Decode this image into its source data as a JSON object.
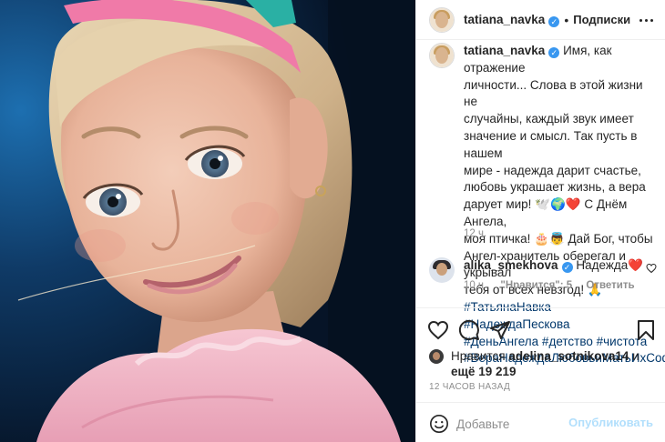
{
  "post": {
    "username": "tatiana_navka",
    "follow_label": "Подписки",
    "caption_lines": [
      "Имя, как отражение",
      "личности... Слова в этой жизни не",
      "случайны, каждый звук имеет",
      "значение и смысл. Так пусть в нашем",
      "мире - надежда дарит счастье,",
      "любовь украшает жизнь, а вера",
      "дарует мир! 🕊️🌍❤️ С Днём Ангела,",
      "моя птичка! 🎂👼 Дай Бог, чтобы",
      "Ангел-хранитель оберегал и укрывал",
      "тебя от всех невзгод! 🙏"
    ],
    "hashtags": [
      "#ТатьянаНавка #НадеждаПескова",
      "#ДеньАнгела #детство #чистота",
      "#ВераНадеждаЛюбовьиМатьИхСофия"
    ],
    "caption_time": "12 ч."
  },
  "comment": {
    "username": "alika_smekhova",
    "text": "Надежда❤️",
    "time": "10 ч.",
    "likes": "\"Нравится\": 5",
    "reply": "Ответить"
  },
  "likes": {
    "prefix": "Нравится",
    "user": "adelina_sotnikova14",
    "and": "и",
    "more_prefix": "ещё",
    "more_count": "19 219"
  },
  "timestamp": "12 часов назад",
  "composer": {
    "placeholder": "Добавьте",
    "publish": "Опубликовать"
  },
  "colors": {
    "verified": "#3897f0",
    "hashtag": "#00376b",
    "muted": "#8e8e8e",
    "publish_disabled": "#b2dffc",
    "heart": "#ed4956"
  },
  "icons": [
    "more-options-icon",
    "verified-icon",
    "heart-icon",
    "comment-icon",
    "share-icon",
    "bookmark-icon",
    "emoji-icon",
    "comment-like-icon"
  ]
}
